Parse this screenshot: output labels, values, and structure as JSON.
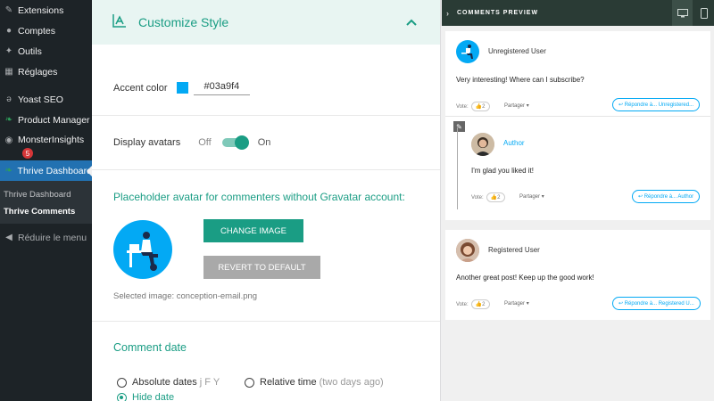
{
  "sidebar": {
    "items": [
      {
        "label": "Extensions",
        "icon": "plugin-icon"
      },
      {
        "label": "Comptes",
        "icon": "users-icon"
      },
      {
        "label": "Outils",
        "icon": "wrench-icon"
      },
      {
        "label": "Réglages",
        "icon": "settings-icon"
      },
      {
        "label": "Yoast SEO",
        "icon": "yoast-icon"
      },
      {
        "label": "Product Manager",
        "icon": "leaf-icon"
      },
      {
        "label": "MonsterInsights",
        "icon": "monster-icon",
        "badge": "5"
      },
      {
        "label": "Thrive Dashboard",
        "icon": "leaf-icon",
        "active": true
      }
    ],
    "submenu": [
      "Thrive Dashboard",
      "Thrive Comments"
    ],
    "collapse_label": "Réduire le menu"
  },
  "panel": {
    "title": "Customize Style",
    "accent_label": "Accent color",
    "accent_value": "#03a9f4",
    "avatars_label": "Display avatars",
    "toggle_off": "Off",
    "toggle_on": "On",
    "toggle_state": true,
    "placeholder_title": "Placeholder avatar for commenters without Gravatar account:",
    "change_image": "CHANGE IMAGE",
    "revert_default": "REVERT TO DEFAULT",
    "selected_image": "Selected image: conception-email.png",
    "comment_date_title": "Comment date",
    "radio_absolute": "Absolute dates",
    "radio_absolute_hint": "j F Y",
    "radio_relative": "Relative time",
    "radio_relative_hint": "(two days ago)",
    "radio_hide": "Hide date",
    "selected_radio": "Hide date"
  },
  "preview": {
    "title": "COMMENTS PREVIEW",
    "comments": [
      {
        "user": "Unregistered User",
        "text": "Very interesting! Where can I subscribe?",
        "vote_label": "Vote:",
        "votes": "2",
        "share": "Partager",
        "reply": "Répondre à... Unregistered..."
      },
      {
        "user": "Author",
        "text": "I'm glad you liked it!",
        "vote_label": "Vote:",
        "votes": "2",
        "share": "Partager",
        "reply": "Répondre à... Author"
      },
      {
        "user": "Registered User",
        "text": "Another great post! Keep up the good work!",
        "vote_label": "Vote:",
        "votes": "2",
        "share": "Partager",
        "reply": "Répondre à... Registered U..."
      }
    ]
  },
  "colors": {
    "accent": "#03a9f4",
    "theme_green": "#1a9d84",
    "wp_sidebar": "#1d2327",
    "wp_active": "#2271b1"
  }
}
